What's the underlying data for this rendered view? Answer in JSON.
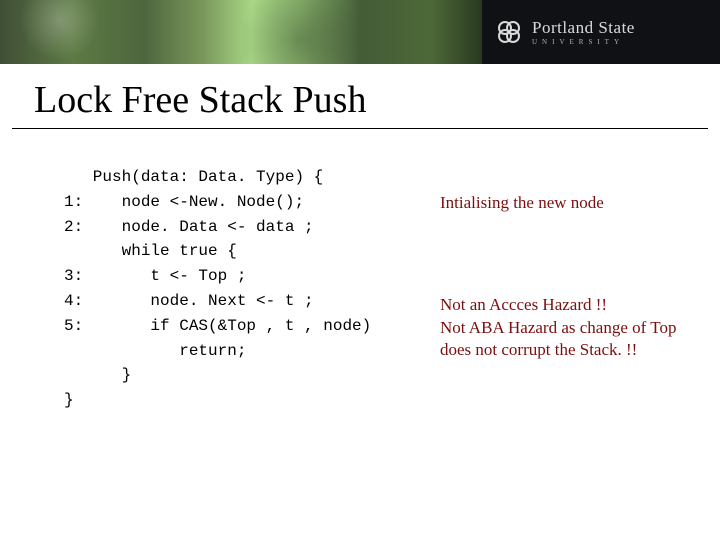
{
  "banner": {
    "university_main": "Portland State",
    "university_sub": "UNIVERSITY"
  },
  "title": "Lock Free Stack Push",
  "codeLines": [
    "   Push(data: Data. Type) {",
    "1:    node <-New. Node();",
    "2:    node. Data <- data ;",
    "      while true {",
    "3:       t <- Top ;",
    "4:       node. Next <- t ;",
    "5:       if CAS(&Top , t , node)",
    "            return;",
    "      }",
    "}"
  ],
  "annotations": {
    "a1": "Intialising the new node",
    "a2": "Not an Accces Hazard !!",
    "a3": "Not ABA Hazard as change of Top does not corrupt the Stack. !!"
  }
}
